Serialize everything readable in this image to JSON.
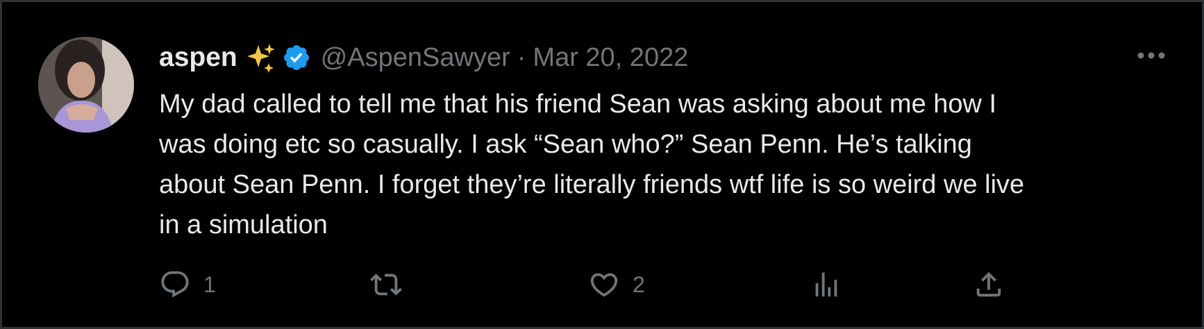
{
  "tweet": {
    "author": {
      "name": "aspen",
      "emoji": "✨",
      "handle": "@AspenSawyer",
      "verified": true
    },
    "separator": "·",
    "date": "Mar 20, 2022",
    "text": "My dad called to tell me that his friend Sean was asking about me how I\nwas doing etc so casually. I ask “Sean who?” Sean Penn. He’s talking\nabout Sean Penn. I forget they’re literally friends wtf life is so weird we live\nin a simulation",
    "actions": {
      "reply_count": "1",
      "retweet_count": "",
      "like_count": "2",
      "views_count": ""
    }
  },
  "icons": {
    "more": "more-icon",
    "reply": "reply-icon",
    "retweet": "retweet-icon",
    "like": "heart-icon",
    "views": "views-icon",
    "share": "share-icon",
    "verified": "verified-badge-icon",
    "sparkle": "sparkles-icon"
  },
  "colors": {
    "background": "#000000",
    "border": "#2f3336",
    "primary_text": "#e7e9ea",
    "secondary_text": "#71767b",
    "verified_blue": "#1d9bf0",
    "sparkle_gold": "#f5c542"
  }
}
